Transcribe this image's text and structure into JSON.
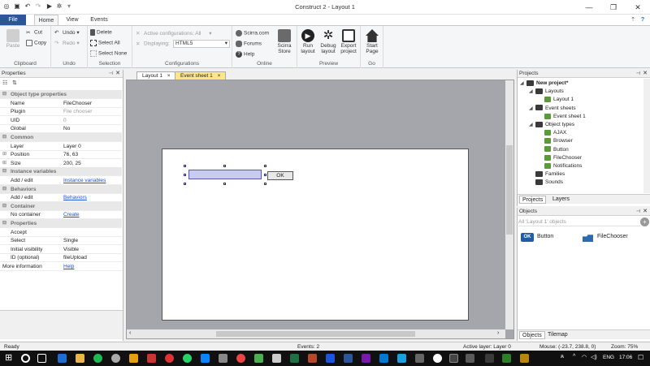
{
  "window": {
    "title": "Construct 2 - Layout 1"
  },
  "ribbon_tabs": [
    "File",
    "Home",
    "View",
    "Events"
  ],
  "ribbon": {
    "clipboard": {
      "label": "Clipboard",
      "paste": "Paste",
      "cut": "Cut",
      "copy": "Copy"
    },
    "undo": {
      "label": "Undo",
      "undo": "Undo",
      "redo": "Redo"
    },
    "selection": {
      "label": "Selection",
      "delete": "Delete",
      "select_all": "Select All",
      "select_none": "Select None"
    },
    "configurations": {
      "label": "Configurations",
      "active": "Active configurations: All",
      "displaying_label": "Displaying:",
      "displaying_value": "HTML5"
    },
    "online": {
      "label": "Online",
      "scirra_com": "Scirra.com",
      "forums": "Forums",
      "help": "Help",
      "store": "Scirra Store"
    },
    "preview": {
      "label": "Preview",
      "run": "Run layout",
      "debug": "Debug layout",
      "export": "Export project"
    },
    "go": {
      "label": "Go",
      "start": "Start Page"
    }
  },
  "properties": {
    "title": "Properties",
    "rows": [
      {
        "type": "section",
        "label": "Object type properties"
      },
      {
        "key": "Name",
        "value": "FileChooser"
      },
      {
        "key": "Plugin",
        "value": "File chooser",
        "dim": true
      },
      {
        "key": "UID",
        "value": "0",
        "dim": true
      },
      {
        "key": "Global",
        "value": "No"
      },
      {
        "type": "section",
        "label": "Common"
      },
      {
        "key": "Layer",
        "value": "Layer 0"
      },
      {
        "key": "Position",
        "value": "76, 63",
        "expand": true
      },
      {
        "key": "Size",
        "value": "200, 25",
        "expand": true
      },
      {
        "type": "section",
        "label": "Instance variables"
      },
      {
        "key": "Add / edit",
        "value": "Instance variables",
        "link": true
      },
      {
        "type": "section",
        "label": "Behaviors"
      },
      {
        "key": "Add / edit",
        "value": "Behaviors",
        "link": true
      },
      {
        "type": "section",
        "label": "Container"
      },
      {
        "key": "No container",
        "value": "Create",
        "link": true
      },
      {
        "type": "section",
        "label": "Properties"
      },
      {
        "key": "Accept",
        "value": ""
      },
      {
        "key": "Select",
        "value": "Single"
      },
      {
        "key": "Initial visibility",
        "value": "Visible"
      },
      {
        "key": "ID (optional)",
        "value": "fileUpload"
      },
      {
        "key": "More information",
        "value": "Help",
        "link": true,
        "nokeyindent": true
      }
    ]
  },
  "document_tabs": [
    {
      "label": "Layout 1",
      "close": "×"
    },
    {
      "label": "Event sheet 1",
      "close": "×"
    }
  ],
  "canvas": {
    "ok_button_label": "OK"
  },
  "projects": {
    "title": "Projects",
    "tree": [
      {
        "label": "New project*",
        "bold": true,
        "level": 0
      },
      {
        "label": "Layouts",
        "level": 1
      },
      {
        "label": "Layout 1",
        "level": 2
      },
      {
        "label": "Event sheets",
        "level": 1
      },
      {
        "label": "Event sheet 1",
        "level": 2
      },
      {
        "label": "Object types",
        "level": 1
      },
      {
        "label": "AJAX",
        "level": 2
      },
      {
        "label": "Browser",
        "level": 2
      },
      {
        "label": "Button",
        "level": 2
      },
      {
        "label": "FileChooser",
        "level": 2
      },
      {
        "label": "Notifications",
        "level": 2
      },
      {
        "label": "Families",
        "level": 1
      },
      {
        "label": "Sounds",
        "level": 1
      }
    ],
    "tabs": [
      "Projects",
      "Layers"
    ]
  },
  "objects": {
    "title": "Objects",
    "filter_placeholder": "All 'Layout 1' objects",
    "items": [
      {
        "label": "Button",
        "icon_text": "OK"
      },
      {
        "label": "FileChooser"
      }
    ],
    "tabs": [
      "Objects",
      "Tilemap"
    ]
  },
  "status": {
    "ready": "Ready",
    "events": "Events: 2",
    "active_layer": "Active layer: Layer 0",
    "mouse": "Mouse: (-23.7, 238.8, 0)",
    "zoom": "Zoom: 75%"
  },
  "taskbar": {
    "language": "ENG",
    "time": "17:06"
  }
}
